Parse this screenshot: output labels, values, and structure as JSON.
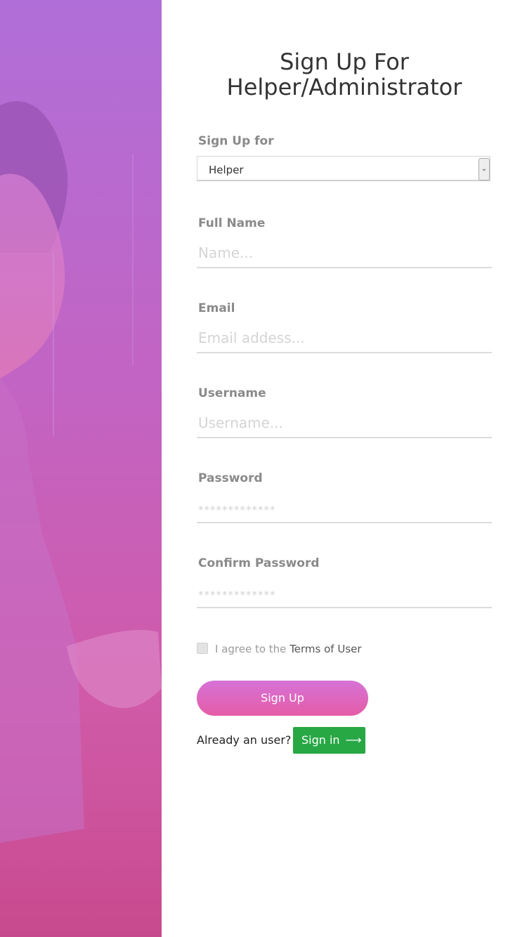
{
  "title": {
    "line1": "Sign Up For",
    "line2": "Helper/Administrator"
  },
  "signup_for": {
    "label": "Sign Up for",
    "selected": "Helper"
  },
  "full_name": {
    "label": "Full Name",
    "placeholder": "Name..."
  },
  "email": {
    "label": "Email",
    "placeholder": "Email addess..."
  },
  "username": {
    "label": "Username",
    "placeholder": "Username..."
  },
  "password": {
    "label": "Password",
    "placeholder": "*************"
  },
  "confirm_password": {
    "label": "Confirm Password",
    "placeholder": "*************"
  },
  "agree": {
    "prefix": "I agree to the ",
    "link": "Terms of User"
  },
  "signup_button": "Sign Up",
  "already_text": "Already an user?",
  "signin_button": "Sign in",
  "colors": {
    "hero_top": "#b06fd8",
    "hero_bottom": "#c84a8e",
    "button_gradient_start": "#d673d8",
    "button_gradient_end": "#e55ca6",
    "signin_green": "#28a745"
  }
}
